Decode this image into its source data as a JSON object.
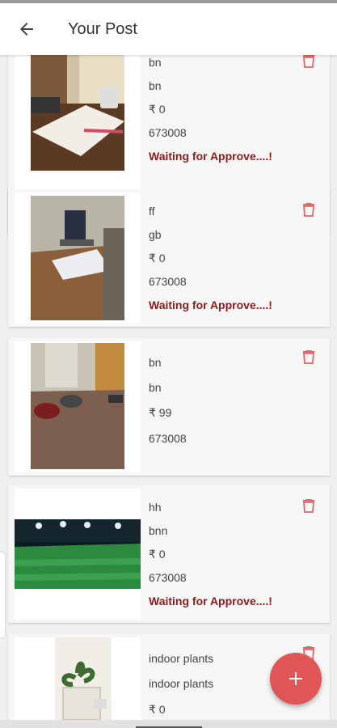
{
  "header": {
    "title": "Your Post",
    "back_icon": "arrow-left-icon"
  },
  "posts": [
    {
      "title": "bn",
      "description": "bn",
      "price": "₹ 0",
      "pincode": "673008",
      "status": "Waiting for Approve....!",
      "image": "desk-notebook-photo"
    },
    {
      "title": "ff",
      "description": "gb",
      "price": "₹ 0",
      "pincode": "673008",
      "status": "Waiting for Approve....!",
      "image": "laptop-on-desk-photo"
    },
    {
      "title": "bn",
      "description": "bn",
      "price": "₹ 99",
      "pincode": "673008",
      "status": "",
      "image": "parking-lot-bikes-photo"
    },
    {
      "title": "hh",
      "description": "bnn",
      "price": "₹ 0",
      "pincode": "673008",
      "status": "Waiting for Approve....!",
      "image": "football-turf-night-photo"
    },
    {
      "title": "indoor plants",
      "description": "indoor plants",
      "price": "₹ 0",
      "pincode": "",
      "status": "",
      "image": "potted-plant-photo"
    }
  ],
  "colors": {
    "accent": "#e05555",
    "status_text": "#8b1a1a",
    "delete_icon": "#e06666"
  },
  "fab": {
    "icon": "plus-icon"
  }
}
